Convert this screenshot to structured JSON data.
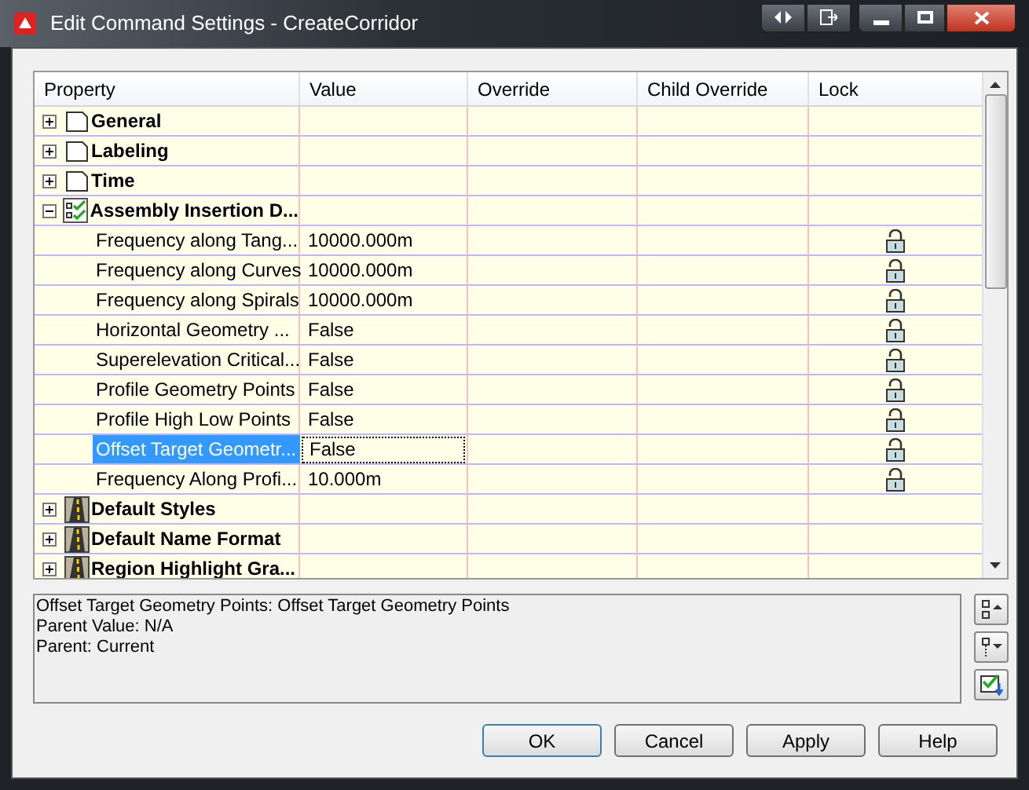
{
  "window": {
    "title": "Edit Command Settings - CreateCorridor"
  },
  "table": {
    "columns": [
      "Property",
      "Value",
      "Override",
      "Child Override",
      "Lock"
    ],
    "rows": [
      {
        "name": "General",
        "kind": "page",
        "expanded": false
      },
      {
        "name": "Labeling",
        "kind": "page",
        "expanded": false
      },
      {
        "name": "Time",
        "kind": "page",
        "expanded": false
      },
      {
        "name": "Assembly Insertion D...",
        "kind": "checklist",
        "expanded": true,
        "children": [
          {
            "name": "Frequency along Tang...",
            "value": "10000.000m",
            "locked": false,
            "selected": false
          },
          {
            "name": "Frequency along Curves",
            "value": "10000.000m",
            "locked": false,
            "selected": false
          },
          {
            "name": "Frequency along Spirals",
            "value": "10000.000m",
            "locked": false,
            "selected": false
          },
          {
            "name": "Horizontal Geometry ...",
            "value": "False",
            "locked": false,
            "selected": false
          },
          {
            "name": "Superelevation Critical...",
            "value": "False",
            "locked": false,
            "selected": false
          },
          {
            "name": "Profile Geometry Points",
            "value": "False",
            "locked": false,
            "selected": false
          },
          {
            "name": "Profile High Low Points",
            "value": "False",
            "locked": false,
            "selected": false
          },
          {
            "name": "Offset Target Geometr...",
            "value": "False",
            "locked": false,
            "selected": true
          },
          {
            "name": "Frequency Along Profi...",
            "value": "10.000m",
            "locked": false,
            "selected": false
          }
        ]
      },
      {
        "name": "Default Styles",
        "kind": "road",
        "expanded": false
      },
      {
        "name": "Default Name Format",
        "kind": "road",
        "expanded": false
      },
      {
        "name": "Region Highlight Gra...",
        "kind": "road",
        "expanded": false
      }
    ]
  },
  "description": [
    "Offset Target Geometry Points: Offset Target Geometry Points",
    "Parent Value: N/A",
    "Parent: Current"
  ],
  "buttons": [
    "OK",
    "Cancel",
    "Apply",
    "Help"
  ]
}
